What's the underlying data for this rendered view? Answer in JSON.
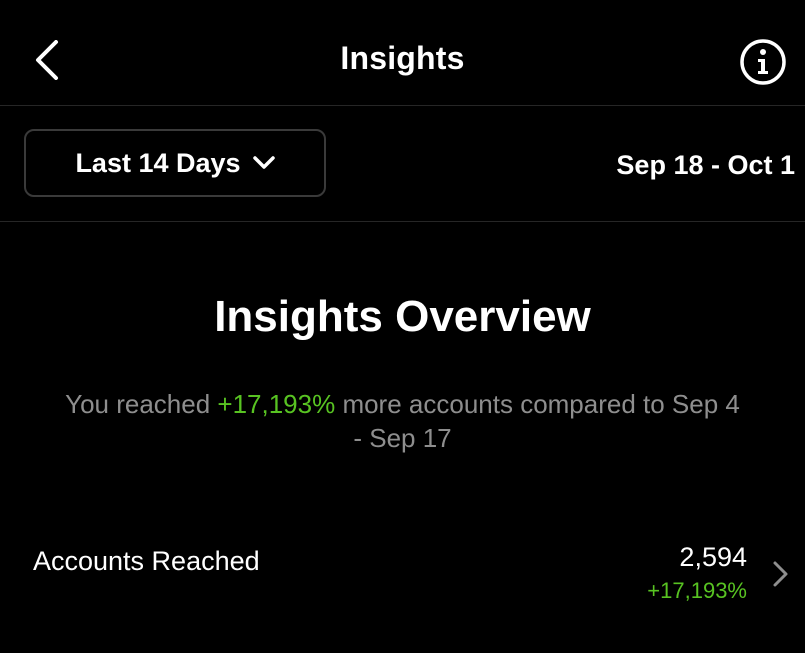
{
  "header": {
    "title": "Insights",
    "back_icon": "chevron-left-icon",
    "info_icon": "info-icon"
  },
  "filter": {
    "selected_range": "Last 14 Days",
    "dropdown_icon": "chevron-down-icon",
    "date_range": "Sep 18 - Oct 1"
  },
  "overview": {
    "heading": "Insights Overview",
    "summary_prefix": "You reached ",
    "summary_change": "+17,193%",
    "summary_suffix": " more accounts compared to Sep 4 - Sep 17"
  },
  "metrics": [
    {
      "label": "Accounts Reached",
      "value": "2,594",
      "change": "+17,193%"
    }
  ],
  "colors": {
    "background": "#000000",
    "positive": "#58c322",
    "muted_text": "#8e8e8e",
    "divider": "#262626"
  }
}
